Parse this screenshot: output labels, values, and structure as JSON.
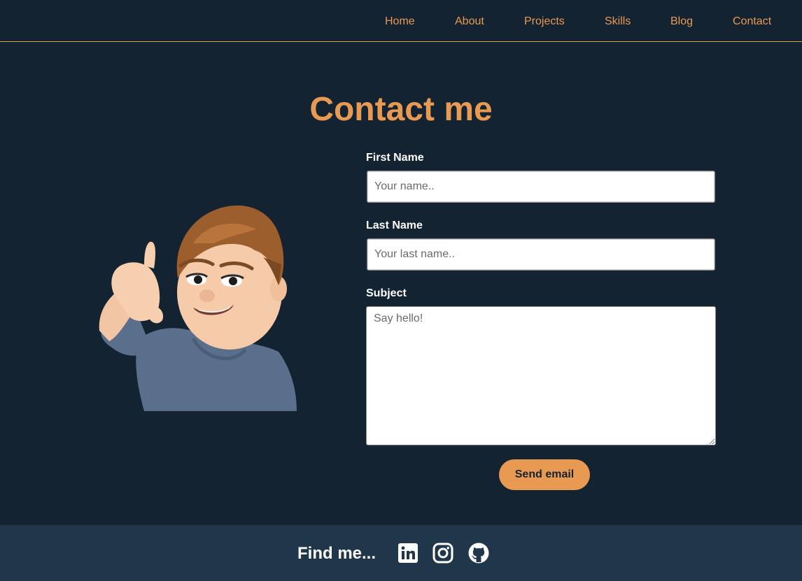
{
  "nav": {
    "items": [
      {
        "label": "Home"
      },
      {
        "label": "About"
      },
      {
        "label": "Projects"
      },
      {
        "label": "Skills"
      },
      {
        "label": "Blog"
      },
      {
        "label": "Contact"
      }
    ]
  },
  "main": {
    "title": "Contact me",
    "form": {
      "first_name": {
        "label": "First Name",
        "placeholder": "Your name..",
        "value": ""
      },
      "last_name": {
        "label": "Last Name",
        "placeholder": "Your last name..",
        "value": ""
      },
      "subject": {
        "label": "Subject",
        "placeholder": "Say hello!",
        "value": ""
      },
      "submit_label": "Send email"
    }
  },
  "footer": {
    "find_label": "Find me...",
    "socials": [
      {
        "icon": "linkedin-icon"
      },
      {
        "icon": "instagram-icon"
      },
      {
        "icon": "github-icon"
      }
    ]
  },
  "colors": {
    "background": "#142331",
    "accent": "#e89a52",
    "footer": "#1f364b"
  }
}
